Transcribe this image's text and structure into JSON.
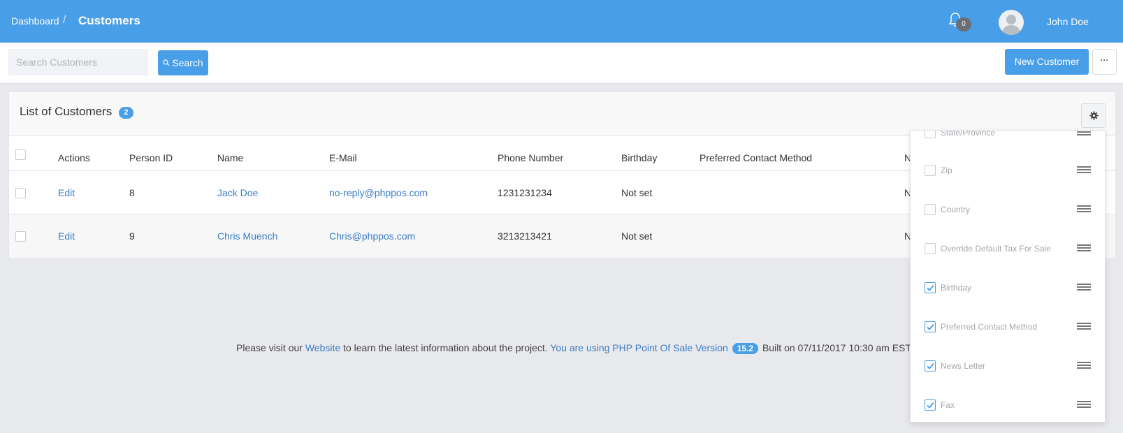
{
  "header": {
    "breadcrumb_root": "Dashboard",
    "breadcrumb_sep": "/",
    "breadcrumb_current": "Customers",
    "notification_count": "0",
    "user_name": "John Doe"
  },
  "toolbar": {
    "search_placeholder": "Search Customers",
    "search_label": "Search",
    "new_label": "New Customer",
    "more_label": "···"
  },
  "panel": {
    "title": "List of Customers",
    "count": "2"
  },
  "table": {
    "columns": [
      "Actions",
      "Person ID",
      "Name",
      "E-Mail",
      "Phone Number",
      "Birthday",
      "Preferred Contact Method",
      "N"
    ],
    "rows": [
      {
        "action": "Edit",
        "person_id": "8",
        "name": "Jack Doe",
        "email": "no-reply@phppos.com",
        "phone": "1231231234",
        "birthday": "Not set",
        "contact": "",
        "n": "N"
      },
      {
        "action": "Edit",
        "person_id": "9",
        "name": "Chris Muench",
        "email": "Chris@phppos.com",
        "phone": "3213213421",
        "birthday": "Not set",
        "contact": "",
        "n": "N"
      }
    ]
  },
  "footer": {
    "prefix": "Please visit our",
    "link": "Website",
    "middle": "to learn the latest information about the project.",
    "version_text": "You are using PHP Point Of Sale Version",
    "version": "15.2",
    "built": "Built on 07/11/2017 10:30 am EST"
  },
  "column_chooser": {
    "items": [
      {
        "label": "State/Province",
        "checked": false
      },
      {
        "label": "Zip",
        "checked": false
      },
      {
        "label": "Country",
        "checked": false
      },
      {
        "label": "Override Default Tax For Sale",
        "checked": false
      },
      {
        "label": "Birthday",
        "checked": true
      },
      {
        "label": "Preferred Contact Method",
        "checked": true
      },
      {
        "label": "News Letter",
        "checked": true
      },
      {
        "label": "Fax",
        "checked": true
      }
    ]
  },
  "colors": {
    "primary": "#489ee7",
    "link": "#3a7dc4",
    "background": "#e8e9ec"
  }
}
